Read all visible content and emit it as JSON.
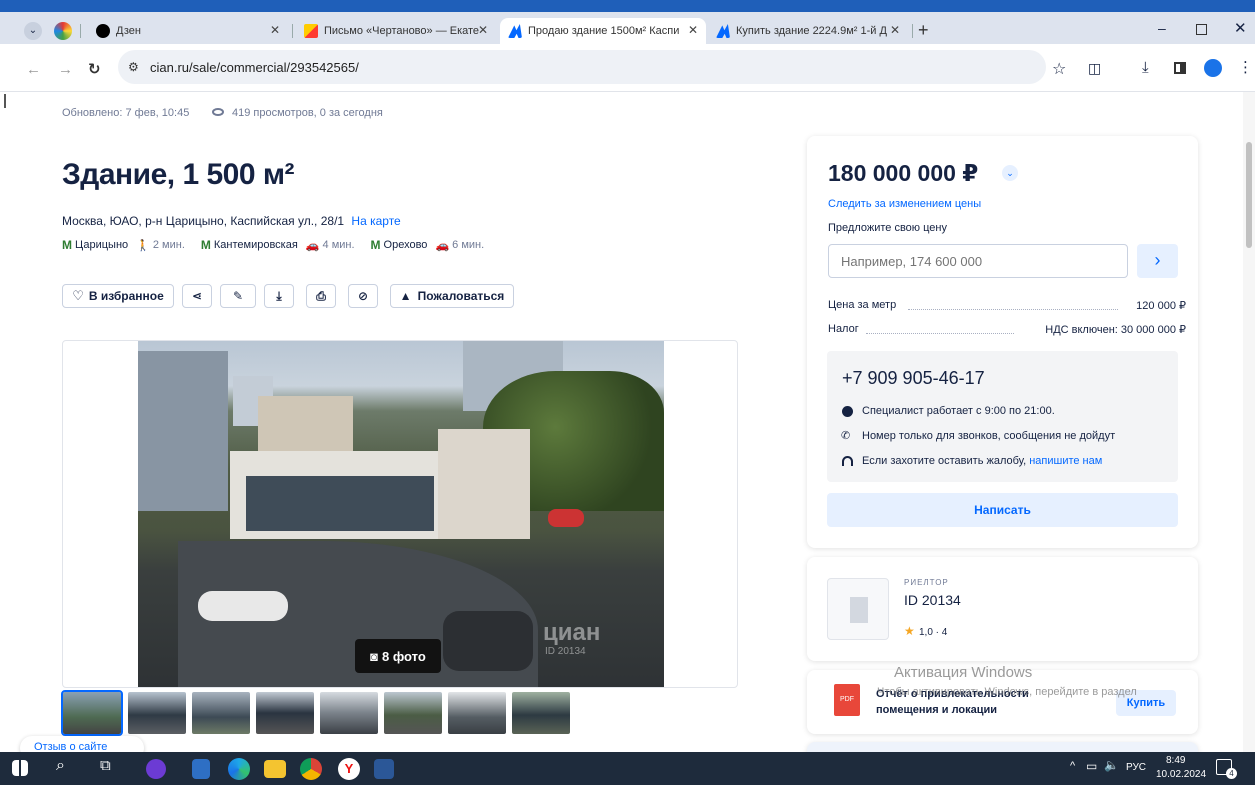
{
  "browser": {
    "tabs": [
      {
        "label": "Дзен",
        "close": "✕"
      },
      {
        "label": "Письмо «Чертаново» — Екате",
        "close": "✕"
      },
      {
        "label": "Продаю здание 1500м² Каспи",
        "close": "✕"
      },
      {
        "label": "Купить здание 2224.9м² 1-й Д",
        "close": "✕"
      }
    ],
    "new_tab": "+",
    "url": "cian.ru/sale/commercial/293542565/"
  },
  "listing": {
    "updated": "Обновлено: 7 фев, 10:45",
    "views": "419 просмотров, 0 за сегодня",
    "title": "Здание, 1 500 м²",
    "address": "Москва, ЮАО, р-н Царицыно, Каспийская ул., 28/1",
    "map_link": "На карте",
    "metro": [
      {
        "name": "Царицыно",
        "time": "2 мин."
      },
      {
        "name": "Кантемировская",
        "time": "4 мин."
      },
      {
        "name": "Орехово",
        "time": "6 мин."
      }
    ],
    "actions": {
      "favorite": "В избранное",
      "complain": "Пожаловаться"
    },
    "photo_count": "8 фото",
    "watermark": "циан",
    "watermark_id": "ID 20134",
    "feedback": "Отзыв о сайте"
  },
  "price_card": {
    "price": "180 000 000 ₽",
    "track": "Следить за изменением цены",
    "offer_label": "Предложите свою цену",
    "offer_placeholder": "Например, 174 600 000",
    "per_meter_label": "Цена за метр",
    "per_meter_value": "120 000 ₽",
    "tax_label": "Налог",
    "tax_value": "НДС включен: 30 000 000 ₽",
    "phone": "+7 909 905-46-17",
    "hours": "Специалист работает с 9:00 по 21:00.",
    "calls_only": "Номер только для звонков, сообщения не дойдут",
    "complaint_text": "Если захотите оставить жалобу,",
    "complaint_link": "напишите нам",
    "write_button": "Написать"
  },
  "agent_card": {
    "role": "РИЕЛТОР",
    "id": "ID 20134",
    "rating": "1,0 · 4"
  },
  "report_card": {
    "title": "Отчёт о привлекательности",
    "subtitle": "помещения и локации",
    "buy": "Купить",
    "pdf": "PDF"
  },
  "windows": {
    "activation_title": "Активация Windows",
    "activation_sub": "Чтобы активировать Windows, перейдите в раздел",
    "lang": "РУС",
    "time": "8:49",
    "date": "10.02.2024",
    "notif_count": "4"
  },
  "colors": {
    "accent": "#0468ff",
    "metro": "#2e7d32",
    "dark": "#152242"
  }
}
